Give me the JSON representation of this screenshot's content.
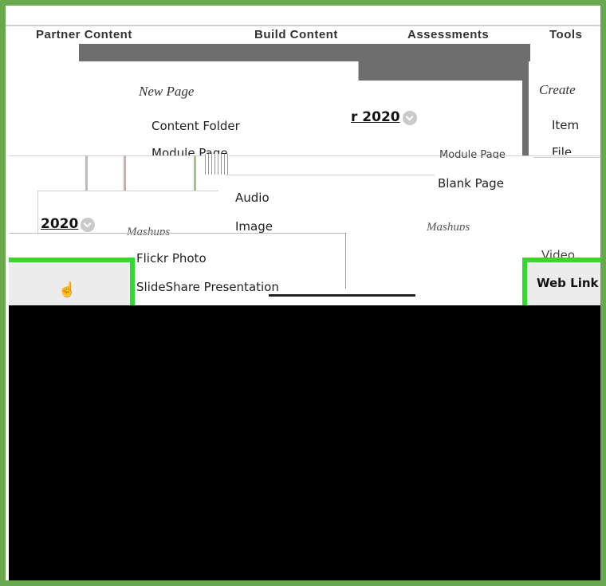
{
  "navbar": {
    "partner_content": "Partner Content",
    "build_content": "Build Content",
    "assessments": "Assessments",
    "tools": "Tools"
  },
  "build_menu": {
    "new_page_heading": "New Page",
    "content_folder": "Content Folder",
    "module_page": "Module Page",
    "audio": "Audio",
    "image": "Image",
    "mashups_heading": "Mashups",
    "flickr_photo": "Flickr Photo",
    "slideshare_presentation": "SlideShare Presentation"
  },
  "right_menu": {
    "module_page": "Module Page",
    "blank_page": "Blank Page",
    "mashups_heading": "Mashups"
  },
  "create_menu": {
    "create_heading": "Create",
    "item": "Item",
    "file": "File",
    "video": "Video",
    "web_link": "Web Link"
  },
  "content": {
    "date_label_right": "r 2020",
    "date_label_left": "2020"
  },
  "icons": [
    "chevron-down-icon",
    "hand-pointer-icon"
  ],
  "colors": {
    "frame_border": "#6aa84f",
    "highlight": "#2edb2e",
    "redaction": "#000000"
  }
}
